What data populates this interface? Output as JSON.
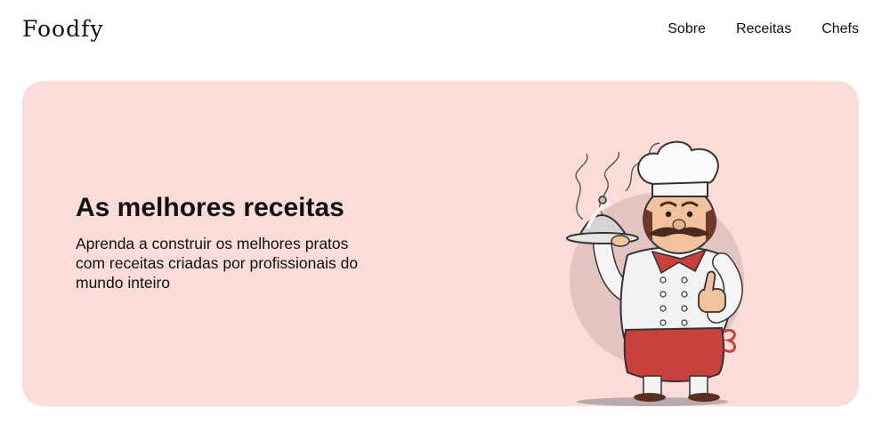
{
  "brand": {
    "logo": "Foodfy"
  },
  "nav": {
    "items": [
      {
        "label": "Sobre"
      },
      {
        "label": "Receitas"
      },
      {
        "label": "Chefs"
      }
    ]
  },
  "hero": {
    "title": "As melhores receitas",
    "text": "Aprenda a construir os melhores pratos com receitas criadas por profissionais do mundo inteiro",
    "background_color": "#fadcd8",
    "illustration": "chef-illustration"
  }
}
